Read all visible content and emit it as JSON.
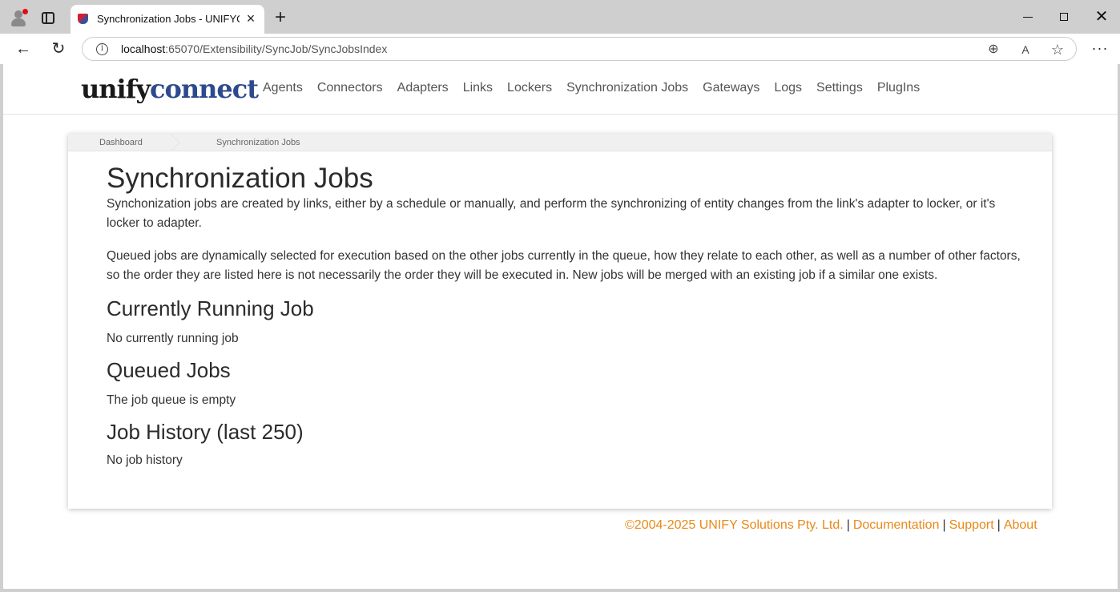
{
  "browser": {
    "tab_title": "Synchronization Jobs - UNIFYConnect",
    "new_tab_label": "+",
    "url_host": "localhost",
    "url_path": ":65070/Extensibility/SyncJob/SyncJobsIndex",
    "icons": [
      "profile-icon",
      "tab-actions-icon",
      "close-icon",
      "back-icon",
      "reload-icon",
      "info-icon",
      "zoom-icon",
      "read-aloud-icon",
      "favorite-icon",
      "more-icon",
      "minimize-icon",
      "maximize-icon"
    ]
  },
  "site": {
    "logo_unify": "unify",
    "logo_connect": "connect",
    "nav": [
      "Agents",
      "Connectors",
      "Adapters",
      "Links",
      "Lockers",
      "Synchronization Jobs",
      "Gateways",
      "Logs",
      "Settings",
      "PlugIns"
    ]
  },
  "breadcrumb": [
    "Dashboard",
    "Synchronization Jobs"
  ],
  "page": {
    "title": "Synchronization Jobs",
    "intro_1": "Synchonization jobs are created by links, either by a schedule or manually, and perform the synchronizing of entity changes from the link's adapter to locker, or it's locker to adapter.",
    "intro_2": "Queued jobs are dynamically selected for execution based on the other jobs currently in the queue, how they relate to each other, as well as a number of other factors, so the order they are listed here is not necessarily the order they will be executed in. New jobs will be merged with an existing job if a similar one exists.",
    "running_heading": "Currently Running Job",
    "running_status": "No currently running job",
    "queued_heading": "Queued Jobs",
    "queued_status": "The job queue is empty",
    "history_heading": "Job History (last 250)",
    "history_status": "No job history"
  },
  "footer": {
    "copyright": "©2004-2025 UNIFY Solutions Pty. Ltd.",
    "separator": "|",
    "documentation": "Documentation",
    "support": "Support",
    "about": "About"
  },
  "colors": {
    "footer_link": "#e8891a",
    "logo_connect": "#2c4a8c"
  }
}
